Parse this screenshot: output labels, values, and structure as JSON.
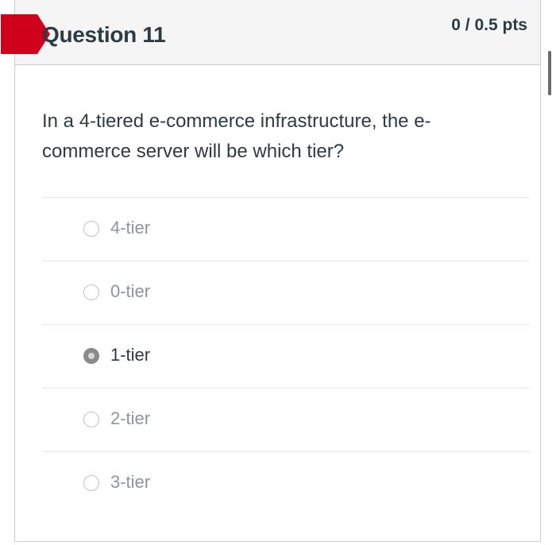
{
  "question": {
    "title": "Question 11",
    "points": "0 / 0.5 pts",
    "text": "In a 4-tiered e-commerce infrastructure, the e-commerce server will be which tier?",
    "flag_color": "#d0021b"
  },
  "answers": [
    {
      "label": "4-tier",
      "selected": false
    },
    {
      "label": "0-tier",
      "selected": false
    },
    {
      "label": "1-tier",
      "selected": true
    },
    {
      "label": "2-tier",
      "selected": false
    },
    {
      "label": "3-tier",
      "selected": false
    }
  ]
}
